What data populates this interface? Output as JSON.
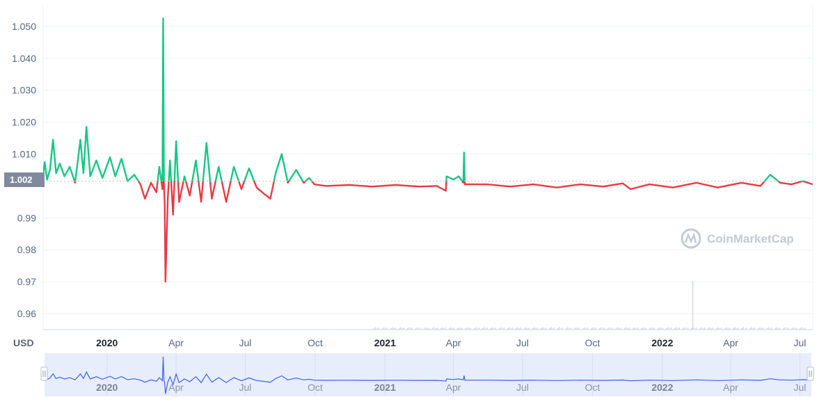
{
  "chart_data": {
    "type": "line",
    "currency_label": "USD",
    "current_price_label": "1.002",
    "baseline": 1.0015,
    "ylim": [
      0.955,
      1.0565
    ],
    "y_ticks": [
      {
        "value": 1.05,
        "label": "1.050"
      },
      {
        "value": 1.04,
        "label": "1.040"
      },
      {
        "value": 1.03,
        "label": "1.030"
      },
      {
        "value": 1.02,
        "label": "1.020"
      },
      {
        "value": 1.01,
        "label": "1.010"
      },
      {
        "value": 0.99,
        "label": "0.99"
      },
      {
        "value": 0.98,
        "label": "0.98"
      },
      {
        "value": 0.97,
        "label": "0.97"
      },
      {
        "value": 0.96,
        "label": "0.96"
      }
    ],
    "x_range": [
      "2019-10-09",
      "2022-07-18"
    ],
    "x_ticks": [
      {
        "date": "2020-01-01",
        "label": "2020",
        "bold": true
      },
      {
        "date": "2020-04-01",
        "label": "Apr",
        "bold": false
      },
      {
        "date": "2020-07-01",
        "label": "Jul",
        "bold": false
      },
      {
        "date": "2020-10-01",
        "label": "Oct",
        "bold": false
      },
      {
        "date": "2021-01-01",
        "label": "2021",
        "bold": true
      },
      {
        "date": "2021-04-01",
        "label": "Apr",
        "bold": false
      },
      {
        "date": "2021-07-01",
        "label": "Jul",
        "bold": false
      },
      {
        "date": "2021-10-01",
        "label": "Oct",
        "bold": false
      },
      {
        "date": "2022-01-01",
        "label": "2022",
        "bold": true
      },
      {
        "date": "2022-04-01",
        "label": "Apr",
        "bold": false
      },
      {
        "date": "2022-07-01",
        "label": "Jul",
        "bold": false
      }
    ],
    "series": [
      {
        "points": [
          [
            "2019-10-09",
            1.0035
          ],
          [
            "2019-10-11",
            1.0075
          ],
          [
            "2019-10-14",
            1.002
          ],
          [
            "2019-10-18",
            1.005
          ],
          [
            "2019-10-22",
            1.0145
          ],
          [
            "2019-10-26",
            1.004
          ],
          [
            "2019-10-31",
            1.007
          ],
          [
            "2019-11-06",
            1.003
          ],
          [
            "2019-11-13",
            1.006
          ],
          [
            "2019-11-20",
            1.001
          ],
          [
            "2019-11-27",
            1.0145
          ],
          [
            "2019-12-01",
            1.004
          ],
          [
            "2019-12-05",
            1.0185
          ],
          [
            "2019-12-10",
            1.003
          ],
          [
            "2019-12-18",
            1.008
          ],
          [
            "2019-12-26",
            1.0025
          ],
          [
            "2020-01-05",
            1.009
          ],
          [
            "2020-01-12",
            1.003
          ],
          [
            "2020-01-20",
            1.0085
          ],
          [
            "2020-01-28",
            1.0015
          ],
          [
            "2020-02-06",
            1.0035
          ],
          [
            "2020-02-14",
            1.0005
          ],
          [
            "2020-02-20",
            0.996
          ],
          [
            "2020-02-28",
            1.001
          ],
          [
            "2020-03-06",
            0.998
          ],
          [
            "2020-03-10",
            1.006
          ],
          [
            "2020-03-14",
            0.999
          ],
          [
            "2020-03-15",
            1.0525
          ],
          [
            "2020-03-16",
            1.001
          ],
          [
            "2020-03-17",
            0.994
          ],
          [
            "2020-03-18",
            0.97
          ],
          [
            "2020-03-21",
            0.996
          ],
          [
            "2020-03-24",
            1.008
          ],
          [
            "2020-03-28",
            0.991
          ],
          [
            "2020-04-01",
            1.014
          ],
          [
            "2020-04-05",
            0.995
          ],
          [
            "2020-04-12",
            1.003
          ],
          [
            "2020-04-19",
            0.997
          ],
          [
            "2020-04-27",
            1.008
          ],
          [
            "2020-05-04",
            0.995
          ],
          [
            "2020-05-11",
            1.0135
          ],
          [
            "2020-05-18",
            0.996
          ],
          [
            "2020-05-27",
            1.006
          ],
          [
            "2020-06-06",
            0.995
          ],
          [
            "2020-06-16",
            1.006
          ],
          [
            "2020-06-26",
            0.999
          ],
          [
            "2020-07-06",
            1.0055
          ],
          [
            "2020-07-16",
            0.9995
          ],
          [
            "2020-07-26",
            0.9975
          ],
          [
            "2020-08-03",
            0.996
          ],
          [
            "2020-08-10",
            1.004
          ],
          [
            "2020-08-18",
            1.01
          ],
          [
            "2020-08-26",
            1.001
          ],
          [
            "2020-09-06",
            1.005
          ],
          [
            "2020-09-16",
            1.001
          ],
          [
            "2020-09-23",
            1.0025
          ],
          [
            "2020-09-30",
            1.0005
          ],
          [
            "2020-10-15",
            1.0
          ],
          [
            "2020-11-15",
            1.0003
          ],
          [
            "2020-12-15",
            0.9998
          ],
          [
            "2021-01-15",
            1.0003
          ],
          [
            "2021-02-15",
            0.9998
          ],
          [
            "2021-03-10",
            1.0
          ],
          [
            "2021-03-22",
            0.9985
          ],
          [
            "2021-03-23",
            1.003
          ],
          [
            "2021-04-01",
            1.002
          ],
          [
            "2021-04-08",
            1.003
          ],
          [
            "2021-04-14",
            1.001
          ],
          [
            "2021-04-15",
            1.0105
          ],
          [
            "2021-04-16",
            1.0005
          ],
          [
            "2021-05-15",
            1.0005
          ],
          [
            "2021-06-15",
            0.9998
          ],
          [
            "2021-07-15",
            1.0005
          ],
          [
            "2021-08-15",
            0.9995
          ],
          [
            "2021-09-15",
            1.0005
          ],
          [
            "2021-10-15",
            0.9998
          ],
          [
            "2021-11-10",
            1.0008
          ],
          [
            "2021-11-20",
            0.999
          ],
          [
            "2021-12-15",
            1.0005
          ],
          [
            "2022-01-15",
            0.9995
          ],
          [
            "2022-02-15",
            1.001
          ],
          [
            "2022-03-15",
            0.9995
          ],
          [
            "2022-04-15",
            1.001
          ],
          [
            "2022-05-10",
            1.0
          ],
          [
            "2022-05-23",
            1.0035
          ],
          [
            "2022-06-05",
            1.001
          ],
          [
            "2022-06-20",
            1.0005
          ],
          [
            "2022-07-05",
            1.0015
          ],
          [
            "2022-07-18",
            1.0005
          ]
        ]
      }
    ],
    "colors": {
      "above": "#16c784",
      "below": "#ea3943",
      "baseline": "#c8c8a8",
      "grid": "#eff2f5",
      "navigator_fill": "#e8edfb",
      "navigator_line": "#3861fb",
      "current_label_bg": "#808a9d",
      "volume": "#c9ced8"
    }
  },
  "watermark": {
    "text": "CoinMarketCap",
    "icon": "coinmarketcap-logo-icon"
  }
}
